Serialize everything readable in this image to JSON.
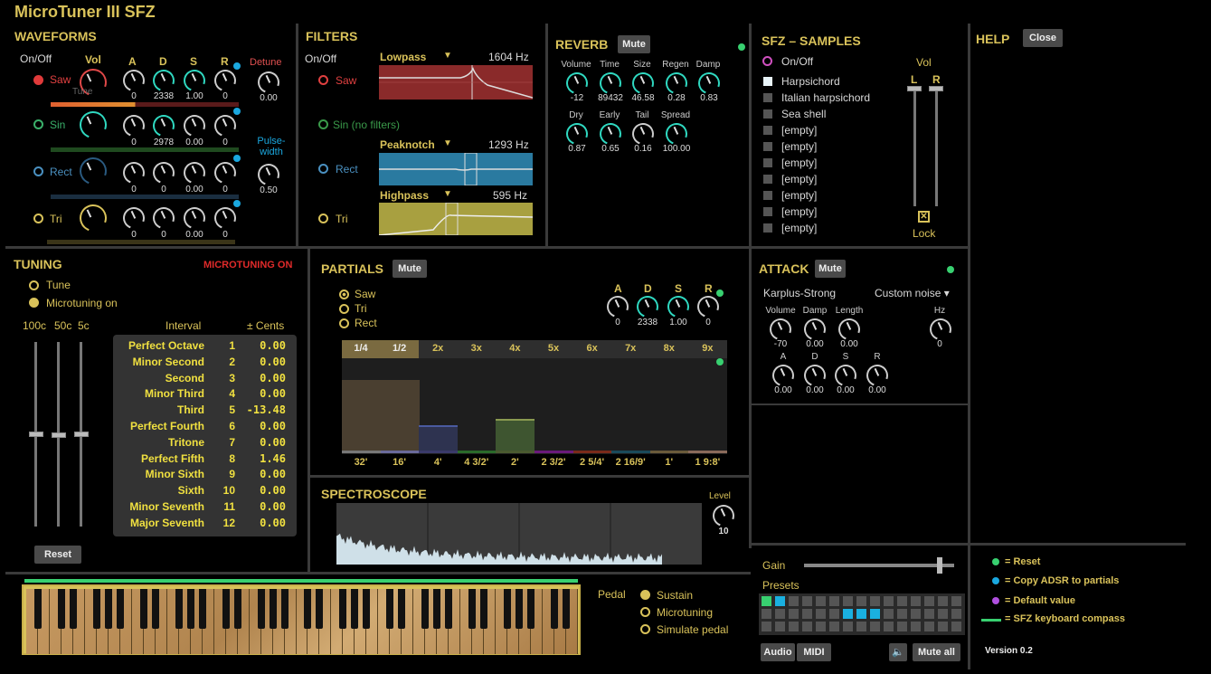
{
  "app": {
    "title": "MicroTuner III SFZ",
    "version": "Version 0.2"
  },
  "waveforms": {
    "title": "WAVEFORMS",
    "onoff": "On/Off",
    "cols": [
      "Vol",
      "A",
      "D",
      "S",
      "R"
    ],
    "detune": "Detune",
    "pulse": "Pulse-\nwidth",
    "tune_label": "Tune",
    "rows": [
      {
        "name": "Saw",
        "vals": [
          "0",
          "2338",
          "1.00",
          "0"
        ]
      },
      {
        "name": "Sin",
        "vals": [
          "0",
          "2978",
          "0.00",
          "0"
        ]
      },
      {
        "name": "Rect",
        "vals": [
          "0",
          "0",
          "0.00",
          "0"
        ]
      },
      {
        "name": "Tri",
        "vals": [
          "0",
          "0",
          "0.00",
          "0"
        ]
      }
    ],
    "detune_val": "0.00",
    "pulse_val": "0.50"
  },
  "filters": {
    "title": "FILTERS",
    "onoff": "On/Off",
    "rows": [
      "Saw",
      "Sin (no filters)",
      "Rect",
      "Tri"
    ],
    "f1": {
      "type": "Lowpass",
      "hz": "1604 Hz"
    },
    "f2": {
      "type": "Peaknotch",
      "hz": "1293 Hz"
    },
    "f3": {
      "type": "Highpass",
      "hz": "595 Hz"
    }
  },
  "reverb": {
    "title": "REVERB",
    "mute": "Mute",
    "k1": [
      {
        "l": "Volume",
        "v": "-12"
      },
      {
        "l": "Time",
        "v": "89432"
      },
      {
        "l": "Size",
        "v": "46.58"
      },
      {
        "l": "Regen",
        "v": "0.28"
      },
      {
        "l": "Damp",
        "v": "0.83"
      }
    ],
    "k2": [
      {
        "l": "Dry",
        "v": "0.87"
      },
      {
        "l": "Early",
        "v": "0.65"
      },
      {
        "l": "Tail",
        "v": "0.16"
      },
      {
        "l": "Spread",
        "v": "100.00"
      }
    ]
  },
  "sfz": {
    "title": "SFZ – SAMPLES",
    "onoff": "On/Off",
    "vol": "Vol",
    "L": "L",
    "R": "R",
    "lock": "Lock",
    "samples": [
      "Harpsichord",
      "Italian harpsichord",
      "Sea shell",
      "[empty]",
      "[empty]",
      "[empty]",
      "[empty]",
      "[empty]",
      "[empty]",
      "[empty]"
    ]
  },
  "help": {
    "title": "HELP",
    "close": "Close"
  },
  "tuning": {
    "title": "TUNING",
    "status": "MICROTUNING ON",
    "tune": "Tune",
    "micro": "Microtuning on",
    "sl": [
      "100c",
      "50c",
      "5c"
    ],
    "interval": "Interval",
    "cents": "± Cents",
    "reset": "Reset",
    "rows": [
      [
        "Perfect Octave",
        "1",
        "0.00"
      ],
      [
        "Minor Second",
        "2",
        "0.00"
      ],
      [
        "Second",
        "3",
        "0.00"
      ],
      [
        "Minor Third",
        "4",
        "0.00"
      ],
      [
        "Third",
        "5",
        "-13.48"
      ],
      [
        "Perfect Fourth",
        "6",
        "0.00"
      ],
      [
        "Tritone",
        "7",
        "0.00"
      ],
      [
        "Perfect Fifth",
        "8",
        "1.46"
      ],
      [
        "Minor Sixth",
        "9",
        "0.00"
      ],
      [
        "Sixth",
        "10",
        "0.00"
      ],
      [
        "Minor Seventh",
        "11",
        "0.00"
      ],
      [
        "Major Seventh",
        "12",
        "0.00"
      ]
    ]
  },
  "partials": {
    "title": "PARTIALS",
    "mute": "Mute",
    "waves": [
      "Saw",
      "Tri",
      "Rect"
    ],
    "adsr": [
      "A",
      "D",
      "S",
      "R"
    ],
    "adsr_v": [
      "0",
      "2338",
      "1.00",
      "0"
    ],
    "top": [
      "1/4",
      "1/2",
      "2x",
      "3x",
      "4x",
      "5x",
      "6x",
      "7x",
      "8x",
      "9x"
    ],
    "bot": [
      "32'",
      "16'",
      "4'",
      "4 3/2'",
      "2'",
      "2 3/2'",
      "2 5/4'",
      "2 16/9'",
      "1'",
      "1 9:8'"
    ],
    "levels": [
      0.76,
      0.76,
      0.27,
      0,
      0.34,
      0,
      0,
      0,
      0,
      0
    ]
  },
  "spectro": {
    "title": "SPECTROSCOPE",
    "level": "Level",
    "level_v": "10"
  },
  "attack": {
    "title": "ATTACK",
    "mute": "Mute",
    "type": "Karplus-Strong",
    "noise": "Custom noise ▾",
    "k1": [
      {
        "l": "Volume",
        "v": "-70"
      },
      {
        "l": "Damp",
        "v": "0.00"
      },
      {
        "l": "Length",
        "v": "0.00"
      }
    ],
    "hz": "Hz",
    "hz_v": "0",
    "k2": [
      {
        "l": "A",
        "v": "0.00"
      },
      {
        "l": "D",
        "v": "0.00"
      },
      {
        "l": "S",
        "v": "0.00"
      },
      {
        "l": "R",
        "v": "0.00"
      }
    ]
  },
  "bottom": {
    "pedal": "Pedal",
    "sustain": "Sustain",
    "microtuning": "Microtuning",
    "simulate": "Simulate pedal",
    "gain": "Gain",
    "presets": "Presets",
    "audio": "Audio",
    "midi": "MIDI",
    "muteall": "Mute all"
  },
  "legend": [
    "= Reset",
    "= Copy ADSR to partials",
    "= Default value",
    "= SFZ keyboard compass"
  ],
  "colors": {
    "accent": "#d9c25a",
    "teal": "#2fd8c0",
    "red": "#e02a2a",
    "green": "#38d070",
    "blue": "#1aa8e0",
    "purple": "#b050e0"
  }
}
